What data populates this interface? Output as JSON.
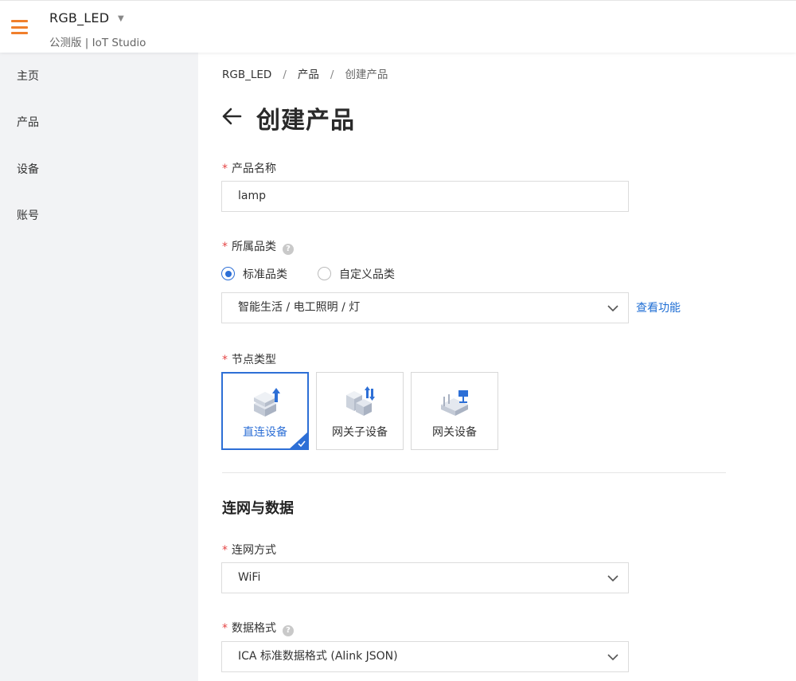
{
  "header": {
    "app_name": "RGB_LED",
    "subtitle": "公测版 | IoT Studio"
  },
  "sidebar": {
    "items": [
      {
        "label": "主页"
      },
      {
        "label": "产品"
      },
      {
        "label": "设备"
      },
      {
        "label": "账号"
      }
    ]
  },
  "breadcrumb": [
    "RGB_LED",
    "产品",
    "创建产品"
  ],
  "page": {
    "title": "创建产品"
  },
  "form": {
    "product_name": {
      "label": "产品名称",
      "required_mark": "*",
      "value": "lamp"
    },
    "category": {
      "label": "所属品类",
      "required_mark": "*",
      "help_icon": "question-circle-icon",
      "options": [
        {
          "label": "标准品类",
          "selected": true
        },
        {
          "label": "自定义品类",
          "selected": false
        }
      ],
      "selected_path": "智能生活 / 电工照明 / 灯",
      "view_link": "查看功能"
    },
    "node_type": {
      "label": "节点类型",
      "required_mark": "*",
      "options": [
        {
          "label": "直连设备",
          "icon": "direct-device-icon",
          "selected": true
        },
        {
          "label": "网关子设备",
          "icon": "gateway-subdevice-icon",
          "selected": false
        },
        {
          "label": "网关设备",
          "icon": "gateway-device-icon",
          "selected": false
        }
      ]
    }
  },
  "network_section": {
    "title": "连网与数据",
    "connection": {
      "label": "连网方式",
      "required_mark": "*",
      "value": "WiFi"
    },
    "data_format": {
      "label": "数据格式",
      "required_mark": "*",
      "help_icon": "question-circle-icon",
      "value": "ICA 标准数据格式 (Alink JSON)"
    }
  },
  "colors": {
    "accent_orange": "#f07f2c",
    "primary_blue": "#2d6fd6",
    "link_blue": "#1f6ed4",
    "required_red": "#e54545",
    "sidebar_bg": "#f2f3f5"
  }
}
